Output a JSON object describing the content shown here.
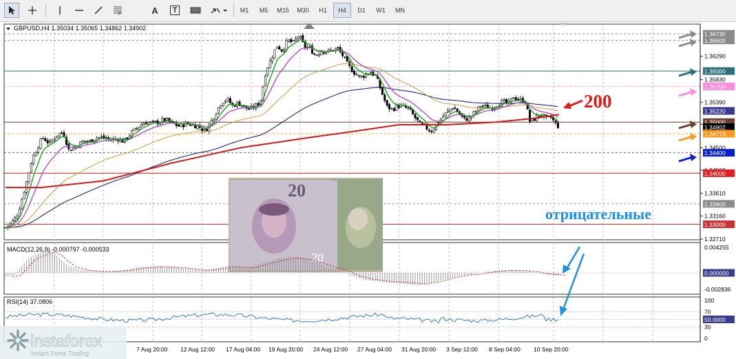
{
  "toolbar": {
    "tools": [
      {
        "name": "cursor-icon"
      },
      {
        "name": "crosshair-icon"
      },
      {
        "name": "vertical-line-icon"
      },
      {
        "name": "horizontal-line-icon"
      },
      {
        "name": "trendline-icon"
      },
      {
        "name": "fibonacci-icon",
        "label": "F"
      },
      {
        "name": "text-icon",
        "label": "A"
      },
      {
        "name": "text-label-icon",
        "label": "T"
      },
      {
        "name": "rectangle-icon"
      },
      {
        "name": "arrows-icon"
      }
    ],
    "timeframes": [
      "M1",
      "M5",
      "M15",
      "M30",
      "H1",
      "H4",
      "D1",
      "W1",
      "MN"
    ],
    "active_timeframe": "H4"
  },
  "chart": {
    "header": "GBPUSD,H4  1.35034 1.35065 1.34862 1.34902",
    "annotation_200": "200",
    "annotation_negative": "отрицательные",
    "logo_text": "instaforex",
    "logo_sub": "Instant Forex Trading",
    "macd_header": "MACD(12,26,9) -0.000797 -0.000533",
    "rsi_header": "RSI(14) 37.0806",
    "price_ticks": [
      "1.36290",
      "1.35830",
      "1.35390",
      "1.34960",
      "1.34500",
      "1.34060",
      "1.33610",
      "1.33160",
      "1.32710"
    ],
    "price_tags": [
      {
        "text": "1.36730",
        "bg": "#8a8a8a",
        "fg": "#ffffff"
      },
      {
        "text": "1.36600",
        "bg": "#8a8a8a",
        "fg": "#ffffff"
      },
      {
        "text": "1.36000",
        "bg": "#2e6f7a",
        "fg": "#ffffff"
      },
      {
        "text": "1.35700",
        "bg": "#ff88e0",
        "fg": "#ffffff"
      },
      {
        "text": "1.35220",
        "bg": "#3a3a90",
        "fg": "#ffffff"
      },
      {
        "text": "1.35000",
        "bg": "#6b3e2e",
        "fg": "#ffffff"
      },
      {
        "text": "1.34902",
        "bg": "#000000",
        "fg": "#ffffff"
      },
      {
        "text": "1.34773",
        "bg": "#ff9a1e",
        "fg": "#ffffff"
      },
      {
        "text": "1.34400",
        "bg": "#0a20d0",
        "fg": "#ffffff"
      },
      {
        "text": "1.34000",
        "bg": "#e02020",
        "fg": "#ffffff"
      },
      {
        "text": "1.33400",
        "bg": "#8a8a8a",
        "fg": "#ffffff"
      },
      {
        "text": "1.33000",
        "bg": "#d03030",
        "fg": "#ffffff"
      }
    ],
    "macd_ticks": [
      "0.004255",
      "0.000000",
      "-0.002836"
    ],
    "rsi_ticks": [
      "100",
      "70",
      "50.0000",
      "30",
      "0"
    ],
    "time_labels": [
      "7 Aug 20:00",
      "12 Aug 12:00",
      "17 Aug 04:00",
      "19 Aug 20:00",
      "24 Aug 12:00",
      "27 Aug 04:00",
      "31 Aug 20:00",
      "3 Sep 12:00",
      "8 Sep 04:00",
      "10 Sep 20:00"
    ],
    "colors": {
      "candle": "#000000",
      "ema_fast": "#1ca01c",
      "ema_mid": "#b050c0",
      "ema_slow": "#d09a40",
      "ema_100": "#1a2a7a",
      "ma_200": "#d01818",
      "annotation_red": "#e01818",
      "annotation_blue": "#1e90e0",
      "macd_hist": "#909090",
      "macd_signal": "#c03030",
      "rsi_line": "#2a6fb0"
    }
  }
}
